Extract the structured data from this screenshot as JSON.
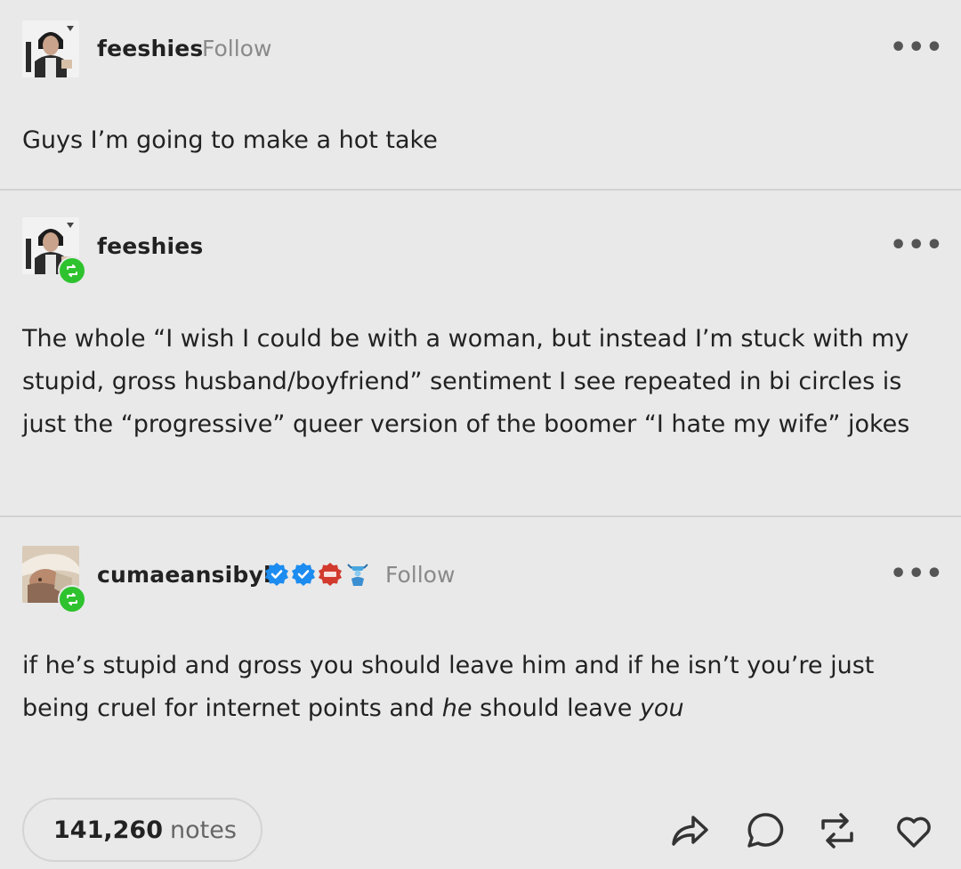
{
  "posts": [
    {
      "username": "feeshies",
      "follow_label": "Follow",
      "more_label": "•••",
      "avatar_icon": "user-avatar-icon",
      "text": "Guys I’m going to make a hot take"
    },
    {
      "username": "feeshies",
      "more_label": "•••",
      "avatar_icon": "user-avatar-icon",
      "reblog_icon": "reblog-icon",
      "text": "The whole “I wish I could be with a woman, but instead I’m stuck with my stupid, gross husband/boyfriend” sentiment I see repeated in bi circles is just the “progressive” queer version of the boomer “I hate my wife” jokes"
    },
    {
      "username": "cumaeansibyl",
      "follow_label": "Follow",
      "more_label": "•••",
      "avatar_icon": "user-avatar-icon",
      "reblog_icon": "reblog-icon",
      "badges": [
        "verified-badge-icon",
        "verified-badge-icon",
        "red-badge-icon",
        "blue-figure-badge-icon"
      ],
      "text_part1": "if he’s stupid and gross you should leave him and if he isn’t you’re just being cruel for internet points and ",
      "text_em1": "he",
      "text_part2": " should leave ",
      "text_em2": "you"
    }
  ],
  "footer": {
    "notes_count": "141,260",
    "notes_label": "notes",
    "actions": [
      "share-icon",
      "reply-icon",
      "reblog-icon",
      "like-icon"
    ]
  },
  "colors": {
    "background": "#e9e9e9",
    "reblog_green": "#2ec32e",
    "verified_blue": "#1d8cf0",
    "red_badge": "#d23a2e",
    "muted_text": "#8a8a8a"
  }
}
